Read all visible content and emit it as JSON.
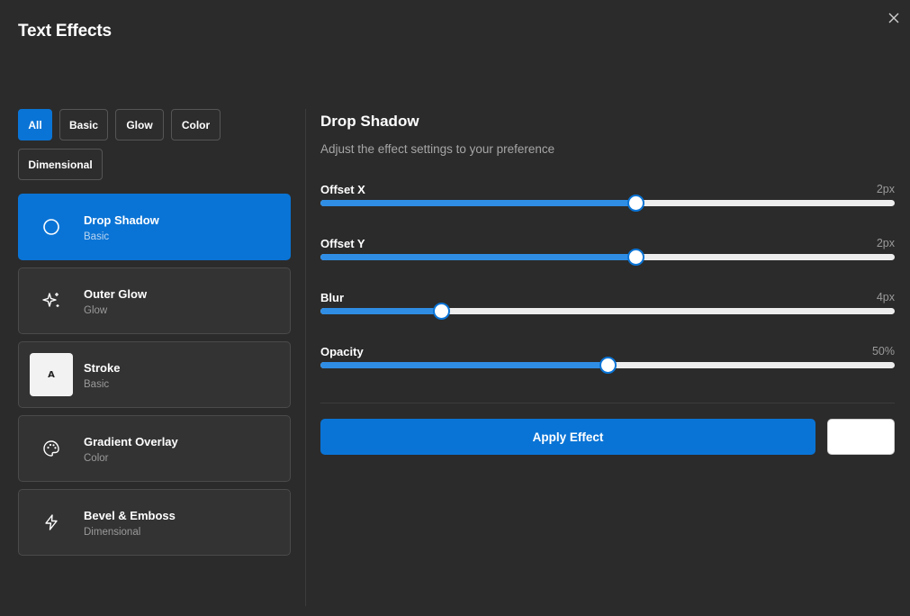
{
  "dialog": {
    "title": "Text Effects"
  },
  "filters": [
    {
      "label": "All",
      "active": true
    },
    {
      "label": "Basic",
      "active": false
    },
    {
      "label": "Glow",
      "active": false
    },
    {
      "label": "Color",
      "active": false
    },
    {
      "label": "Dimensional",
      "active": false
    }
  ],
  "effects": [
    {
      "name": "Drop Shadow",
      "category": "Basic",
      "icon": "circle-icon",
      "active": true
    },
    {
      "name": "Outer Glow",
      "category": "Glow",
      "icon": "sparkle-icon",
      "active": false
    },
    {
      "name": "Stroke",
      "category": "Basic",
      "icon": "stroke-thumbnail",
      "thumb_text": "A",
      "active": false
    },
    {
      "name": "Gradient Overlay",
      "category": "Color",
      "icon": "palette-icon",
      "active": false
    },
    {
      "name": "Bevel & Emboss",
      "category": "Dimensional",
      "icon": "lightning-icon",
      "active": false
    }
  ],
  "panel": {
    "title": "Drop Shadow",
    "subtitle": "Adjust the effect settings to your preference",
    "sliders": [
      {
        "label": "Offset X",
        "value": "2px",
        "fraction": 0.549
      },
      {
        "label": "Offset Y",
        "value": "2px",
        "fraction": 0.549
      },
      {
        "label": "Blur",
        "value": "4px",
        "fraction": 0.21
      },
      {
        "label": "Opacity",
        "value": "50%",
        "fraction": 0.5
      }
    ],
    "apply_label": "Apply Effect"
  },
  "colors": {
    "accent": "#0a74d6",
    "background": "#2b2b2b",
    "card": "#333333"
  }
}
